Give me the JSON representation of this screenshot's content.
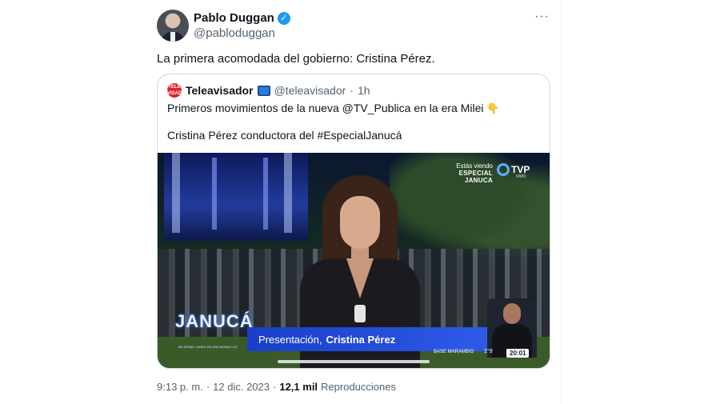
{
  "author": {
    "name": "Pablo Duggan",
    "handle": "@pabloduggan",
    "verified_icon": "verified-badge-icon",
    "more_icon": "···"
  },
  "tweet": {
    "text": "La primera acomodada del gobierno: Cristina Pérez."
  },
  "quoted": {
    "logo_text": "TELE VISADOR",
    "name": "Teleavisador",
    "emoji": "tv-icon",
    "handle": "@teleavisador",
    "dot": "·",
    "time": "1h",
    "line1": "Primeros movimientos de la nueva @TV_Publica en la era Milei",
    "line1_emoji": "👇",
    "line2": "Cristina Pérez conductora del #EspecialJanucá",
    "video": {
      "tvp_watching": "Estás viendo",
      "tvp_program": "ESPECIAL JANUCA",
      "tvp_brand": "TVP",
      "tvp_live": "VIVO",
      "show_logo": "JANUCÁ",
      "show_logo_sub": "8M ISRAEL UNIDO EN UNA MISMA LUZ",
      "lower_third_prefix": "Presentación,",
      "lower_third_name": "Cristina Pérez",
      "base": "BASE MARAMBIO",
      "temp": "1°9",
      "clock": "20:01"
    }
  },
  "footer": {
    "time": "9:13 p. m.",
    "sep1": "·",
    "date": "12 dic. 2023",
    "sep2": "·",
    "views_count": "12,1 mil",
    "views_label": "Reproducciones"
  }
}
